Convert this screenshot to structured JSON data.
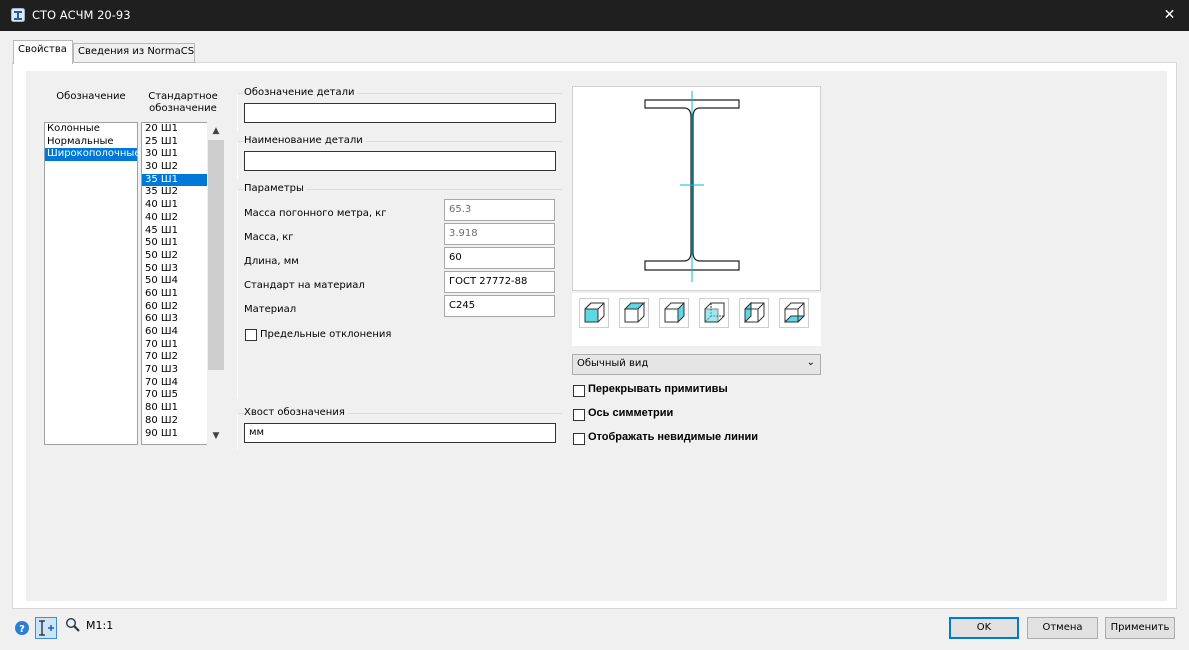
{
  "window": {
    "title": "СТО АСЧМ 20-93",
    "close": "✕"
  },
  "tabs": [
    "Свойства",
    "Сведения из NormaCS"
  ],
  "lists": {
    "type_header": "Обозначение",
    "std_header_1": "Стандартное",
    "std_header_2": "обозначение",
    "types": [
      "Колонные",
      "Нормальные",
      "Широкополочные"
    ],
    "selected_type": "Широкополочные",
    "standards": [
      "20 Ш1",
      "25 Ш1",
      "30 Ш1",
      "30 Ш2",
      "35 Ш1",
      "35 Ш2",
      "40 Ш1",
      "40 Ш2",
      "45 Ш1",
      "50 Ш1",
      "50 Ш2",
      "50 Ш3",
      "50 Ш4",
      "60 Ш1",
      "60 Ш2",
      "60 Ш3",
      "60 Ш4",
      "70 Ш1",
      "70 Ш2",
      "70 Ш3",
      "70 Ш4",
      "70 Ш5",
      "80 Ш1",
      "80 Ш2",
      "90 Ш1"
    ],
    "selected_standard": "35 Ш1"
  },
  "detail": {
    "designation_label": "Обозначение детали",
    "designation_value": "",
    "name_label": "Наименование детали",
    "name_value": ""
  },
  "params": {
    "label": "Параметры",
    "mass_per_m_label": "Масса погонного метра, кг",
    "mass_per_m_value": "65.3",
    "mass_label": "Масса, кг",
    "mass_value": "3.918",
    "length_label": "Длина, мм",
    "length_value": "60",
    "material_std_label": "Стандарт на материал",
    "material_std_value": "ГОСТ 27772-88",
    "material_label": "Материал",
    "material_value": "С245",
    "tolerances_label": "Предельные отклонения"
  },
  "tail": {
    "label": "Хвост обозначения",
    "value": "мм"
  },
  "view": {
    "mode": "Обычный вид",
    "overlap_label": "Перекрывать примитивы",
    "symmetry_label": "Ось симметрии",
    "hidden_lines_label": "Отображать невидимые линии"
  },
  "footer": {
    "scale": "М1:1",
    "ok": "OK",
    "cancel": "Отмена",
    "apply": "Применить"
  },
  "colors": {
    "accent": "#0078d7",
    "preview_cyan": "#00bcd4",
    "cube_fill": "#5ed8e3"
  }
}
